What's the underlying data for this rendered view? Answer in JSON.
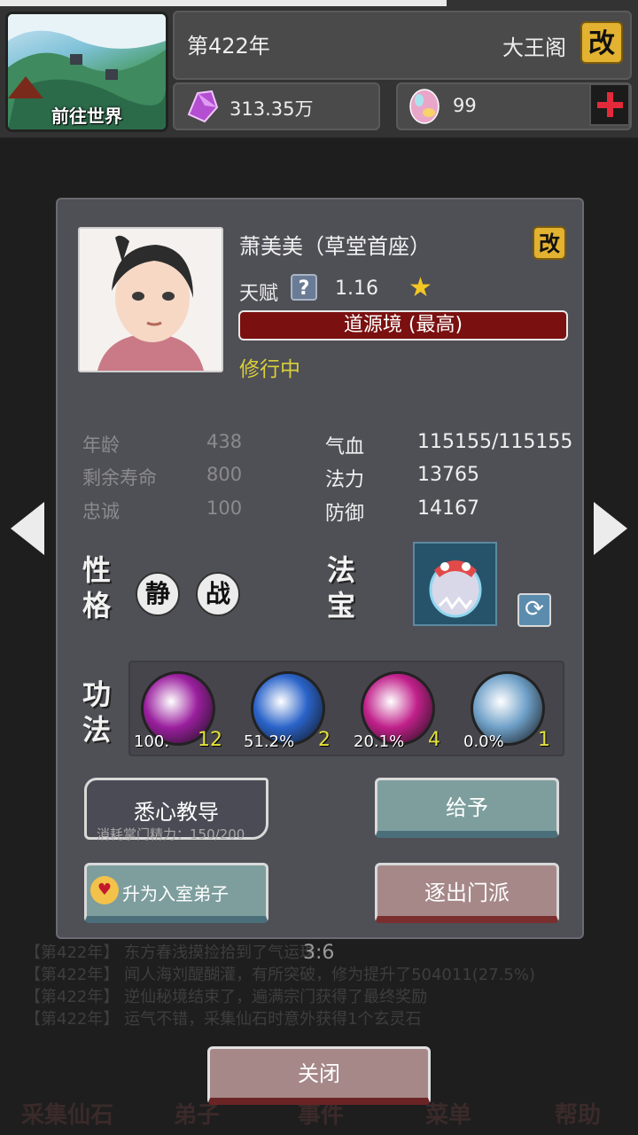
{
  "header": {
    "world_button": "前往世界",
    "year": "第422年",
    "sect_name": "大王阁",
    "rename_label": "改",
    "spirit_stones": "313.35万",
    "gems": "99"
  },
  "background": {
    "log_lines": [
      "【第422年】 东方春浅摸捡拾到了气运珠",
      "【第422年】 闻人海刘醍醐灌，有所突破，修为提升了504011(27.5%)",
      "【第422年】 逆仙秘境结束了，遍满宗门获得了最终奖励",
      "【第422年】 运气不错，采集仙石时意外获得1个玄灵石"
    ],
    "clock": "3:6",
    "nav": [
      "采集仙石",
      "弟子",
      "事件",
      "菜单",
      "帮助"
    ]
  },
  "disciple": {
    "name": "萧美美（草堂首座）",
    "rename_label": "改",
    "talent_label": "天赋",
    "talent_help": "?",
    "talent_value": "1.16",
    "realm": "道源境 (最高)",
    "status": "修行中",
    "stats_left": [
      {
        "label": "年龄",
        "value": "438"
      },
      {
        "label": "剩余寿命",
        "value": "800"
      },
      {
        "label": "忠诚",
        "value": "100"
      }
    ],
    "stats_right": [
      {
        "label": "气血",
        "value": "115155/115155"
      },
      {
        "label": "法力",
        "value": "13765"
      },
      {
        "label": "防御",
        "value": "14167"
      }
    ],
    "personality_title": [
      "性",
      "格"
    ],
    "traits": [
      "静",
      "战"
    ],
    "treasure_title": [
      "法",
      "宝"
    ],
    "skills_title": [
      "功",
      "法"
    ],
    "skills": [
      {
        "progress": "100.",
        "level": "12",
        "color": "#9a1f9e"
      },
      {
        "progress": "51.2%",
        "level": "2",
        "color": "#2a63c9"
      },
      {
        "progress": "20.1%",
        "level": "4",
        "color": "#c0208a"
      },
      {
        "progress": "0.0%",
        "level": "1",
        "color": "#6fa0c8"
      }
    ]
  },
  "actions": {
    "teach": "悉心教导",
    "teach_cost": "消耗掌门精力：150/200",
    "give": "给予",
    "promote": "升为入室弟子",
    "expel": "逐出门派",
    "close": "关闭"
  },
  "colors": {
    "realm_bg": "#7a1010",
    "status_text": "#d9cf3a",
    "level_text": "#e4e33a",
    "rename_bg": "#e2b230"
  }
}
